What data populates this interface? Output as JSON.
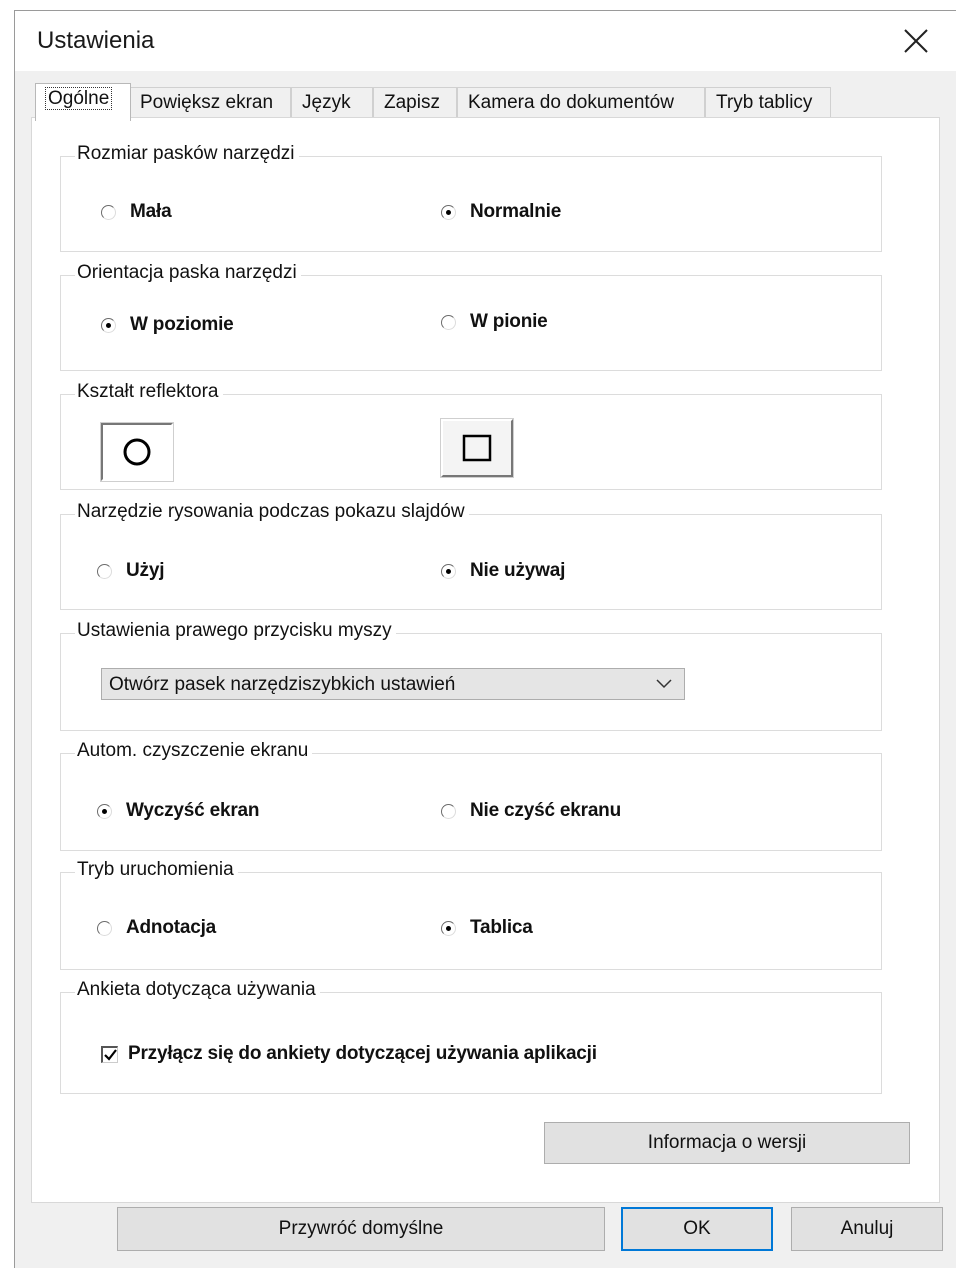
{
  "window": {
    "title": "Ustawienia"
  },
  "tabs": [
    {
      "label": "Ogólne",
      "active": true
    },
    {
      "label": "Powiększ ekran"
    },
    {
      "label": "Język"
    },
    {
      "label": "Zapisz"
    },
    {
      "label": "Kamera do dokumentów"
    },
    {
      "label": "Tryb tablicy"
    }
  ],
  "groups": {
    "toolbar_size": {
      "legend": "Rozmiar pasków narzędzi",
      "options": [
        {
          "label": "Mała",
          "checked": false
        },
        {
          "label": "Normalnie",
          "checked": true
        }
      ]
    },
    "toolbar_orientation": {
      "legend": "Orientacja paska narzędzi",
      "options": [
        {
          "label": "W poziomie",
          "checked": true
        },
        {
          "label": "W pionie",
          "checked": false
        }
      ]
    },
    "spotlight_shape": {
      "legend": "Kształt reflektora",
      "options": [
        {
          "icon": "circle-icon",
          "selected": true
        },
        {
          "icon": "square-icon",
          "selected": false
        }
      ]
    },
    "slideshow_drawing": {
      "legend": "Narzędzie rysowania podczas pokazu slajdów",
      "options": [
        {
          "label": "Użyj",
          "checked": false
        },
        {
          "label": "Nie używaj",
          "checked": true
        }
      ]
    },
    "right_click": {
      "legend": "Ustawienia prawego przycisku myszy",
      "selected": "Otwórz pasek narzędziszybkich ustawień"
    },
    "auto_clear": {
      "legend": "Autom. czyszczenie ekranu",
      "options": [
        {
          "label": "Wyczyść ekran",
          "checked": true
        },
        {
          "label": "Nie czyść ekranu",
          "checked": false
        }
      ]
    },
    "startup_mode": {
      "legend": "Tryb uruchomienia",
      "options": [
        {
          "label": "Adnotacja",
          "checked": false
        },
        {
          "label": "Tablica",
          "checked": true
        }
      ]
    },
    "usage_survey": {
      "legend": "Ankieta dotycząca używania",
      "checkbox_label": "Przyłącz się do ankiety dotyczącej używania aplikacji",
      "checked": true
    }
  },
  "buttons": {
    "version_info": "Informacja o wersji",
    "restore_defaults": "Przywróć domyślne",
    "ok": "OK",
    "cancel": "Anuluj"
  },
  "colors": {
    "accent": "#0078d7",
    "dialog_bg": "#f0f0f0",
    "panel_bg": "#ffffff"
  }
}
